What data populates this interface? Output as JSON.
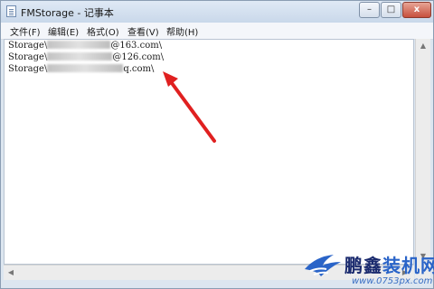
{
  "window": {
    "title": "FMStorage - 记事本",
    "controls": {
      "minimize": "–",
      "maximize": "□",
      "close": "x"
    }
  },
  "menubar": {
    "items": [
      {
        "label": "文件(F)"
      },
      {
        "label": "编辑(E)"
      },
      {
        "label": "格式(O)"
      },
      {
        "label": "查看(V)"
      },
      {
        "label": "帮助(H)"
      }
    ]
  },
  "editor": {
    "lines": [
      {
        "prefix": "Storage\\",
        "suffix": "@163.com\\"
      },
      {
        "prefix": "Storage\\",
        "suffix": "@126.com\\"
      },
      {
        "prefix": "Storage\\",
        "suffix": "q.com\\"
      }
    ]
  },
  "annotation": {
    "color": "#e02020"
  },
  "watermark": {
    "brand_part1": "鹏鑫",
    "brand_part2": "装机网",
    "url": "www.0753px.com"
  }
}
